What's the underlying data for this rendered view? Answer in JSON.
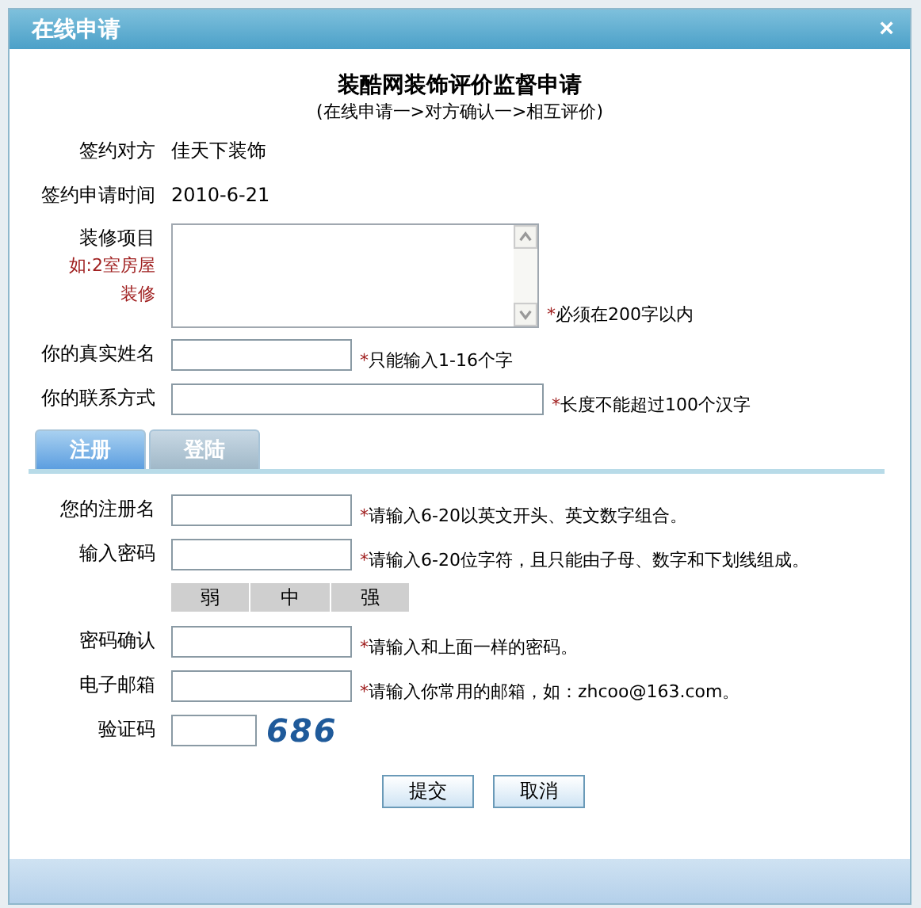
{
  "window": {
    "title": "在线申请",
    "close": "×"
  },
  "heading": "装酷网装饰评价监督申请",
  "subheading": "(在线申请一>对方确认一>相互评价)",
  "info": [
    {
      "label": "签约对方",
      "value": "佳天下装饰"
    },
    {
      "label": "签约申请时间",
      "value": "2010-6-21"
    }
  ],
  "fields": [
    {
      "kind": "textarea",
      "label": "装修项目",
      "example": "如:2室房屋装修",
      "mark": "*",
      "hint": "必须在200字以内"
    },
    {
      "kind": "text",
      "label": "你的真实姓名",
      "mark": "*",
      "hint": "只能输入1-16个字"
    },
    {
      "kind": "wide",
      "label": "你的联系方式",
      "mark": "*",
      "hint": "长度不能超过100个汉字"
    }
  ],
  "tabs": [
    {
      "label": "注册",
      "selected": true
    },
    {
      "label": "登陆",
      "selected": false
    }
  ],
  "register_fields": [
    {
      "kind": "text",
      "label": "您的注册名",
      "mark": "*",
      "hint": "请输入6-20以英文开头、英文数字组合。"
    },
    {
      "kind": "text",
      "label": "输入密码",
      "mark": "*",
      "hint": "请输入6-20位字符，且只能由子母、数字和下划线组成。"
    },
    {
      "kind": "strength",
      "levels": [
        "弱",
        "中",
        "强"
      ]
    },
    {
      "kind": "text",
      "label": "密码确认",
      "mark": "*",
      "hint": "请输入和上面一样的密码。"
    },
    {
      "kind": "text",
      "label": "电子邮箱",
      "mark": "*",
      "hint": "请输入你常用的邮箱，如：zhcoo@163.com。"
    },
    {
      "kind": "captcha",
      "label": "验证码",
      "code": "686"
    }
  ],
  "buttons": [
    "提交",
    "取消"
  ]
}
